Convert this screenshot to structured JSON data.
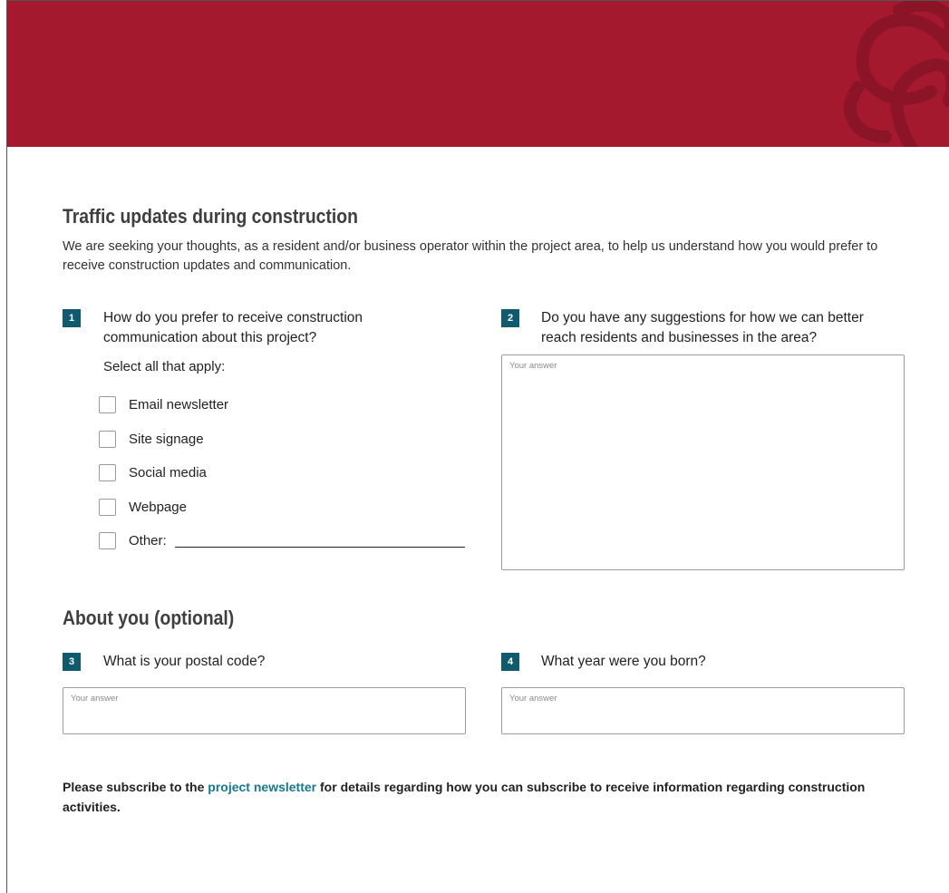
{
  "section1": {
    "title": "Traffic updates during construction",
    "intro": "We are seeking your thoughts, as a resident and/or business operator within the project area, to help us understand how you would prefer to receive construction updates and communication."
  },
  "q1": {
    "number": "1",
    "text_line1": "How do you prefer to receive construction",
    "text_line2": "communication about this project?",
    "select_hint": "Select all that apply:",
    "options": [
      "Email newsletter",
      "Site signage",
      "Social media",
      "Webpage",
      "Other:"
    ]
  },
  "q2": {
    "number": "2",
    "text_line1": "Do you have any suggestions for how we can better",
    "text_line2": "reach residents and businesses in the area?",
    "placeholder": "Your answer"
  },
  "section2": {
    "title": "About you (optional)"
  },
  "q3": {
    "number": "3",
    "text": "What is your postal code?",
    "placeholder": "Your answer"
  },
  "q4": {
    "number": "4",
    "text": "What year were you born?",
    "placeholder": "Your answer"
  },
  "footer": {
    "before": "Please subscribe to the ",
    "link": "project newsletter",
    "after": " for details regarding how you can subscribe to receive information regarding construction activities."
  },
  "colors": {
    "banner": "#a4192d",
    "badge": "#0f5a6e",
    "link": "#147a8c"
  },
  "banner_logo": "knot-logo"
}
